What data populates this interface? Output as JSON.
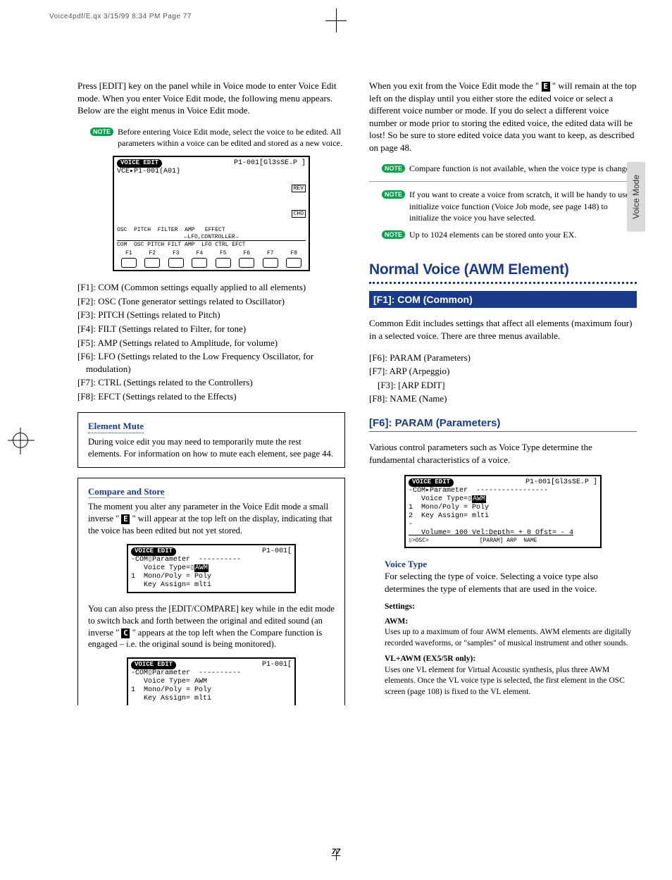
{
  "header": "Voice4pdf/E.qx  3/15/99  8:34 PM  Page 77",
  "side_tab": "Voice Mode",
  "page_number": "77",
  "left": {
    "intro": "Press [EDIT] key on the panel while in Voice mode to enter Voice Edit mode. When you enter Voice Edit mode, the following menu appears. Below are the eight menus in Voice Edit mode.",
    "note1": "Before entering Voice Edit mode, select the voice to be edited. All parameters within a voice can be edited and stored as a new voice.",
    "lcd1": {
      "tag": "VOICE EDIT",
      "right": "P1-001[Gl3sSE.P    ]",
      "line1": "VCE▸P1-001(A01)",
      "rev": "REV",
      "cho": "CHO",
      "blocks": "OSC  PITCH  FILTER  AMP   EFFECT",
      "lfo": "←LFO,CONTROLLER→",
      "bottom": "COM  OSC PITCH FILT AMP  LFO CTRL EFCT",
      "fkeys": [
        "F1",
        "F2",
        "F3",
        "F4",
        "F5",
        "F6",
        "F7",
        "F8"
      ]
    },
    "flist": [
      "[F1]: COM (Common settings equally applied to all elements)",
      "[F2]: OSC (Tone generator settings related to Oscillator)",
      "[F3]: PITCH (Settings related to Pitch)",
      "[F4]: FILT (Settings related to Filter, for tone)",
      "[F5]: AMP (Settings related to Amplitude, for volume)",
      "[F6]: LFO (Settings related to the Low Frequency Oscillator, for modulation)",
      "[F7]: CTRL (Settings related to the Controllers)",
      "[F8]: EFCT (Settings related to the Effects)"
    ],
    "element_mute": {
      "title": "Element Mute",
      "body": "During voice edit you may need to temporarily mute the rest elements. For information on how to mute each element, see page 44."
    },
    "compare": {
      "title": "Compare and Store",
      "p1a": "The moment you alter any parameter in the Voice Edit mode a small inverse \" ",
      "p1b": " \" will appear at the top left on the display, indicating that the voice has been edited but not yet stored.",
      "lcd2_tag": "VOICE EDIT",
      "lcd2_right": "P1-001[",
      "lcd2_l1": "-COM▯Parameter  ----------",
      "lcd2_l2": "   Voice Type=▯",
      "lcd2_l2b": "AWM",
      "lcd2_l3": "1  Mono/Poly = Poly",
      "lcd2_l4": "   Key Assign= mlti",
      "p2a": "You can also press the [EDIT/COMPARE] key while in the edit mode to switch back and forth between the original and edited sound (an inverse \" ",
      "p2b": " \" appears at the top left when the Compare function is engaged – i.e. the original sound is being monitored).",
      "lcd3_tag": "VOICE EDIT",
      "lcd3_right": "P1-001[",
      "lcd3_l1": "-COM▯Parameter  ----------",
      "lcd3_l2": "   Voice Type= AWM",
      "lcd3_l3": "1  Mono/Poly = Poly",
      "lcd3_l4": "   Key Assign= mlti"
    }
  },
  "right": {
    "p1a": "When you exit from the Voice Edit mode the \" ",
    "p1b": " \" will remain at the top left on the display until you either store the edited voice or select a different voice number or mode. If you do select a different voice number or mode prior to storing the edited voice, the edited data will be lost! So be sure to store edited voice data you want to keep, as described on page 48.",
    "note2": "Compare function is not available, when the voice type is changed.",
    "note3": "If you want to create a voice from scratch, it will be handy to use initialize voice function (Voice Job mode, see page 148) to initialize the voice you have selected.",
    "note4": "Up to 1024 elements can be stored onto your EX.",
    "big_title": "Normal Voice (AWM Element)",
    "bar": "[F1]: COM (Common)",
    "com_intro": "Common Edit includes settings that affect all elements (maximum four) in a selected voice. There are three menus available.",
    "com_list": [
      "[F6]: PARAM (Parameters)",
      "[F7]: ARP (Arpeggio)",
      "   [F3]: [ARP EDIT]",
      "[F8]: NAME (Name)"
    ],
    "sec_hd": "[F6]: PARAM (Parameters)",
    "param_intro": "Various control parameters such as Voice Type determine the fundamental characteristics of a voice.",
    "lcd4": {
      "tag": "VOICE EDIT",
      "right": "P1-001[Gl3sSE.P    ]",
      "l1": "-COM▸Parameter  -----------------",
      "l2a": "   Voice Type=▯",
      "l2b": "AWM",
      "l3": "1  Mono/Poly = Poly",
      "l4": "2  Key Assign= mlti",
      "l5": "-",
      "l6": "   Volume= 100 Vel:Depth= + 0 Ofst= - 4",
      "l7": "▯>OSC>               [PARAM] ARP  NAME"
    },
    "voice_type": {
      "title": "Voice Type",
      "body": "For selecting the type of voice. Selecting a voice type also determines the type of elements that are used in the voice."
    },
    "settings_label": "Settings:",
    "awm": {
      "title": "AWM:",
      "body": "Uses up to a maximum of four AWM elements. AWM elements are digitally recorded waveforms, or \"samples\" of musical instrument and other sounds."
    },
    "vlawm": {
      "title": "VL+AWM (EX5/5R only):",
      "body": "Uses one VL element for Virtual Acoustic synthesis, plus three AWM elements. Once the VL voice type is selected, the first element in the OSC screen (page 108) is fixed to the VL element."
    }
  }
}
